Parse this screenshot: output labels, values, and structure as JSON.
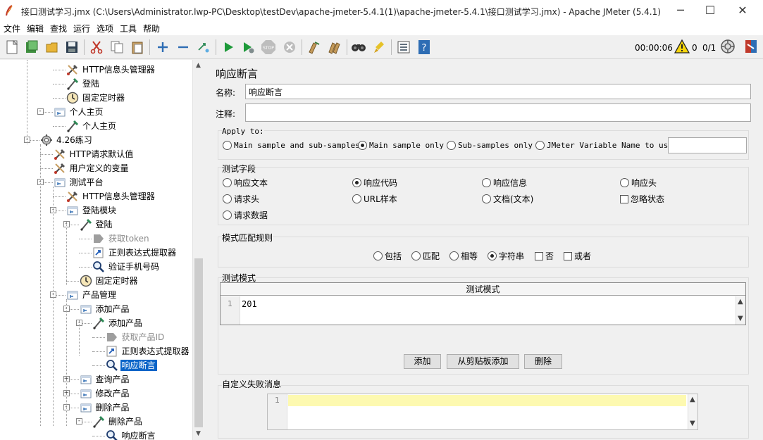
{
  "window": {
    "title": "接口测试学习.jmx (C:\\Users\\Administrator.lwp-PC\\Desktop\\testDev\\apache-jmeter-5.4.1(1)\\apache-jmeter-5.4.1\\接口测试学习.jmx) - Apache JMeter (5.4.1)",
    "minimize": "─",
    "maximize": "☐",
    "close": "✕"
  },
  "menu": [
    "文件",
    "编辑",
    "查找",
    "运行",
    "选项",
    "工具",
    "帮助"
  ],
  "toolbar": {
    "timer": "00:00:06",
    "error_count": "0",
    "threads": "0/1",
    "icons": [
      "new-icon",
      "templates-icon",
      "open-icon",
      "save-icon",
      "cut-icon",
      "copy-icon",
      "paste-icon",
      "expand-icon",
      "collapse-icon",
      "toggle-icon",
      "start-icon",
      "start-no-pause-icon",
      "stop-icon",
      "shutdown-icon",
      "clear-icon",
      "clear-all-icon",
      "search-icon",
      "reset-search-icon",
      "function-helper-icon",
      "help-icon"
    ]
  },
  "tree": {
    "items": [
      {
        "label": "HTTP信息头管理器",
        "icon": "wrench-icon",
        "level": 4
      },
      {
        "label": "登陆",
        "icon": "sampler-icon",
        "level": 4
      },
      {
        "label": "固定定时器",
        "icon": "timer-icon",
        "level": 4
      },
      {
        "label": "个人主页",
        "icon": "controller-icon",
        "level": 3
      },
      {
        "label": "个人主页",
        "icon": "sampler-icon",
        "level": 4
      },
      {
        "label": "4.26练习",
        "icon": "threadgroup-icon",
        "level": 2
      },
      {
        "label": "HTTP请求默认值",
        "icon": "wrench-icon",
        "level": 3
      },
      {
        "label": "用户定义的变量",
        "icon": "wrench-icon",
        "level": 3
      },
      {
        "label": "测试平台",
        "icon": "controller-icon",
        "level": 3
      },
      {
        "label": "HTTP信息头管理器",
        "icon": "wrench-icon",
        "level": 4
      },
      {
        "label": "登陆模块",
        "icon": "controller-icon",
        "level": 4
      },
      {
        "label": "登陆",
        "icon": "sampler-icon",
        "level": 5
      },
      {
        "label": "获取token",
        "icon": "extractor-disabled-icon",
        "level": 6
      },
      {
        "label": "正则表达式提取器",
        "icon": "regex-icon",
        "level": 6
      },
      {
        "label": "验证手机号码",
        "icon": "assertion-icon",
        "level": 6
      },
      {
        "label": "固定定时器",
        "icon": "timer-icon",
        "level": 5
      },
      {
        "label": "产品管理",
        "icon": "controller-icon",
        "level": 4
      },
      {
        "label": "添加产品",
        "icon": "controller-icon",
        "level": 5
      },
      {
        "label": "添加产品",
        "icon": "sampler-icon",
        "level": 6
      },
      {
        "label": "获取产品ID",
        "icon": "extractor-disabled-icon",
        "level": 7
      },
      {
        "label": "正则表达式提取器",
        "icon": "regex-icon",
        "level": 7
      },
      {
        "label": "响应断言",
        "icon": "assertion-icon",
        "level": 7
      },
      {
        "label": "查询产品",
        "icon": "controller-icon",
        "level": 5
      },
      {
        "label": "修改产品",
        "icon": "controller-icon",
        "level": 5
      },
      {
        "label": "删除产品",
        "icon": "controller-icon",
        "level": 5
      },
      {
        "label": "删除产品",
        "icon": "sampler-icon",
        "level": 6
      },
      {
        "label": "响应断言",
        "icon": "assertion-icon",
        "level": 7
      }
    ]
  },
  "panel": {
    "title": "响应断言",
    "name_label": "名称:",
    "name_value": "响应断言",
    "comment_label": "注释:",
    "comment_value": "",
    "apply_to": {
      "title": "Apply to:",
      "options": [
        "Main sample and sub-samples",
        "Main sample only",
        "Sub-samples only",
        "JMeter Variable Name to use"
      ],
      "selected": "Main sample only",
      "variable_value": ""
    },
    "field_to_test": {
      "title": "测试字段",
      "options": [
        "响应文本",
        "响应代码",
        "响应信息",
        "响应头",
        "请求头",
        "URL样本",
        "文档(文本)",
        "请求数据"
      ],
      "selected": "响应代码",
      "ignore_status_label": "忽略状态",
      "ignore_status_checked": false
    },
    "pattern_matching": {
      "title": "模式匹配规则",
      "options": [
        "包括",
        "匹配",
        "相等",
        "字符串"
      ],
      "selected": "字符串",
      "not_label": "否",
      "or_label": "或者"
    },
    "patterns": {
      "title": "测试模式",
      "column_header": "测试模式",
      "rows": [
        {
          "line": "1",
          "value": "201"
        }
      ],
      "add_button": "添加",
      "add_clipboard_button": "从剪贴板添加",
      "delete_button": "删除"
    },
    "custom_failure": {
      "title": "自定义失败消息",
      "line": "1",
      "value": ""
    }
  }
}
